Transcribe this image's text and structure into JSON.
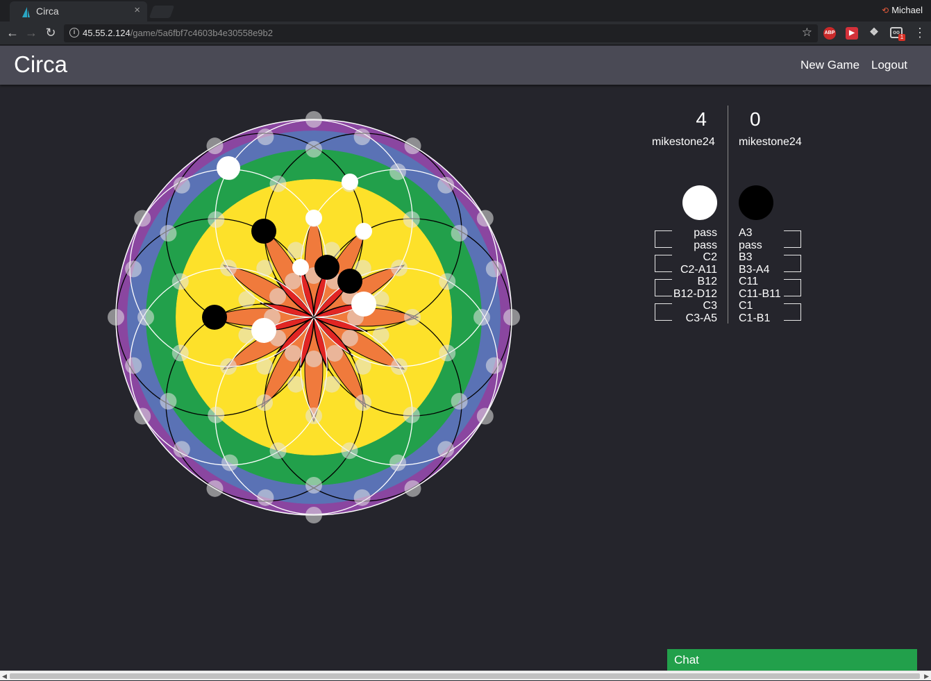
{
  "browser": {
    "tab_title": "Circa",
    "tab_close": "×",
    "profile_name": "Michael",
    "url_host": "45.55.2.124",
    "url_path": "/game/5a6fbf7c4603b4e30558e9b2",
    "back_icon": "←",
    "forward_icon": "→",
    "reload_icon": "↻",
    "star_icon": "☆",
    "menu_icon": "⋮",
    "ext_abp": "ABP",
    "ext_badge": "1"
  },
  "navbar": {
    "brand": "Circa",
    "links": [
      "New Game",
      "Logout"
    ]
  },
  "board": {
    "colors": {
      "purple": "#8a46a0",
      "blue": "#5a72b5",
      "green": "#22a04b",
      "yellow": "#fde12a",
      "orange": "#f07a3c",
      "red": "#e12624"
    }
  },
  "players": [
    {
      "score": "4",
      "name": "mikestone24",
      "stone_color": "#ffffff",
      "moves": [
        "pass",
        "pass",
        "C2",
        "C2-A11",
        "B12",
        "B12-D12",
        "C3",
        "C3-A5"
      ]
    },
    {
      "score": "0",
      "name": "mikestone24",
      "stone_color": "#000000",
      "moves": [
        "A3",
        "pass",
        "B3",
        "B3-A4",
        "C11",
        "C11-B11",
        "C1",
        "C1-B1"
      ]
    }
  ],
  "chat": {
    "label": "Chat"
  }
}
